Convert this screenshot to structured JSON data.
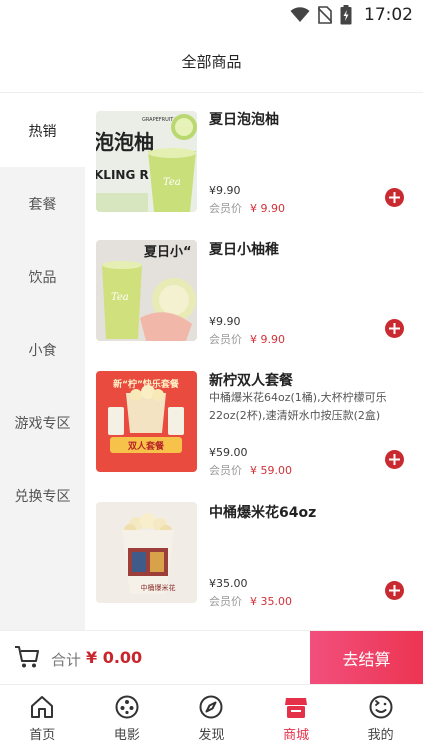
{
  "status_bar": {
    "time": "17:02"
  },
  "header": {
    "title": "全部商品"
  },
  "sidebar": {
    "categories": [
      {
        "label": "热销"
      },
      {
        "label": "套餐"
      },
      {
        "label": "饮品"
      },
      {
        "label": "小食"
      },
      {
        "label": "游戏专区"
      },
      {
        "label": "兑换专区"
      }
    ],
    "active_index": 0
  },
  "products": [
    {
      "name": "夏日泡泡柚",
      "price": "¥9.90",
      "member_label": "会员价",
      "member_price": "¥ 9.90",
      "image_text": {
        "line1": "泡泡柚",
        "line2": "GRAPEFRUIT JUICE",
        "line3": "KLING R",
        "cup": "Tea"
      }
    },
    {
      "name": "夏日小柚稚",
      "price": "¥9.90",
      "member_label": "会员价",
      "member_price": "¥ 9.90",
      "image_text": {
        "line1": "夏日小“",
        "cup": "Tea"
      }
    },
    {
      "name": "新柠双人套餐",
      "description": "中桶爆米花64oz(1桶),大杯柠檬可乐22oz(2杯),速清妍水巾按压款(2盒)",
      "price": "¥59.00",
      "member_label": "会员价",
      "member_price": "¥ 59.00",
      "image_text": {
        "line1": "新“柠”快乐套餐",
        "line2": "双人套餐"
      }
    },
    {
      "name": "中桶爆米花64oz",
      "price": "¥35.00",
      "member_label": "会员价",
      "member_price": "¥ 35.00",
      "image_text": {
        "line1": "中桶爆米花"
      }
    }
  ],
  "cart": {
    "total_label": "合计",
    "total_amount": "¥ 0.00",
    "checkout_label": "去结算"
  },
  "tabbar": {
    "tabs": [
      {
        "label": "首页",
        "icon": "home-icon"
      },
      {
        "label": "电影",
        "icon": "film-reel-icon"
      },
      {
        "label": "发现",
        "icon": "compass-icon"
      },
      {
        "label": "商城",
        "icon": "shop-icon"
      },
      {
        "label": "我的",
        "icon": "profile-icon"
      }
    ],
    "active_index": 3
  },
  "colors": {
    "accent": "#e53049",
    "price_red": "#d03239",
    "add_button": "#c92a30"
  }
}
